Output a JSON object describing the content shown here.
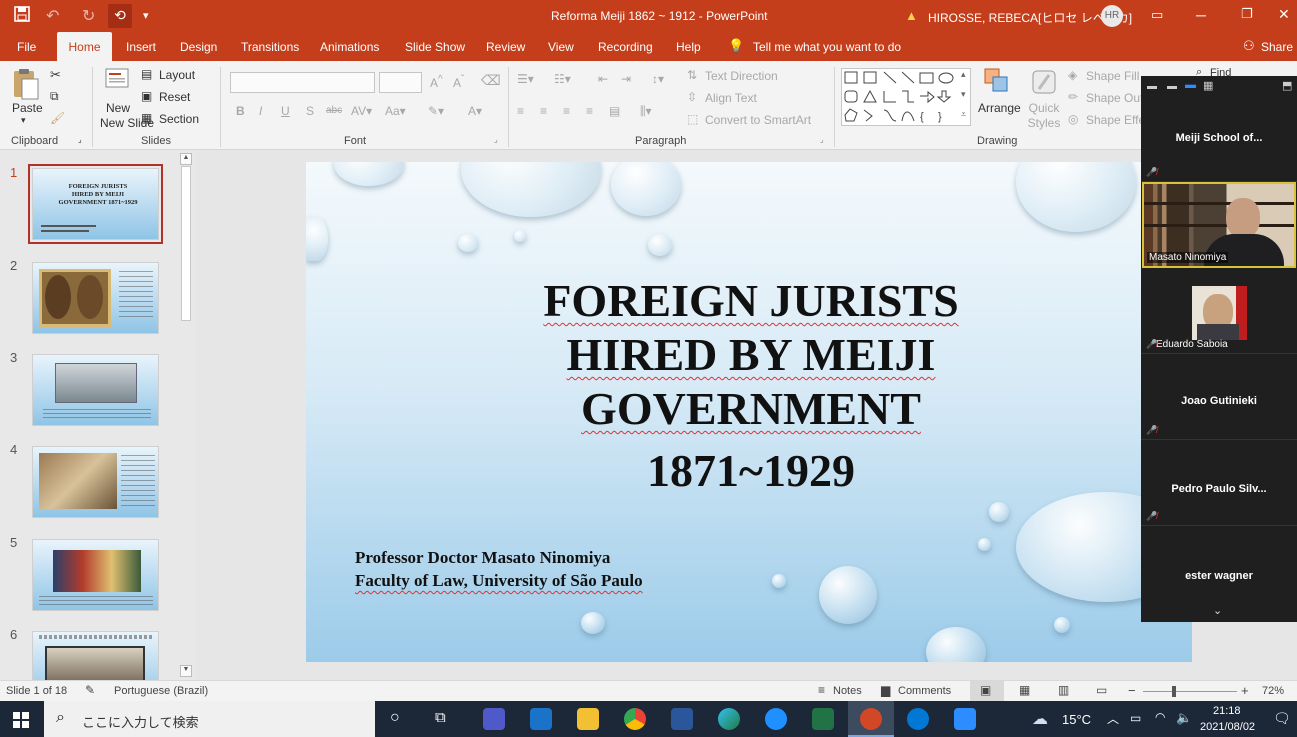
{
  "title_bar": {
    "document_title": "Reforma Meiji 1862 ~ 1912  -  PowerPoint",
    "user_name": "HIROSSE, REBECA[ヒロセ レベッカ]",
    "user_initials": "HR"
  },
  "tabs": [
    "File",
    "Home",
    "Insert",
    "Design",
    "Transitions",
    "Animations",
    "Slide Show",
    "Review",
    "View",
    "Recording",
    "Help"
  ],
  "tell_me": "Tell me what you want to do",
  "share": "Share",
  "ribbon": {
    "clipboard": {
      "paste": "Paste",
      "label": "Clipboard"
    },
    "slides": {
      "new_slide": "New Slide",
      "layout": "Layout",
      "reset": "Reset",
      "section": "Section",
      "label": "Slides"
    },
    "font": {
      "label": "Font"
    },
    "paragraph": {
      "text_direction": "Text Direction",
      "align_text": "Align Text",
      "smartart": "Convert to SmartArt",
      "label": "Paragraph"
    },
    "drawing": {
      "arrange": "Arrange",
      "quick_styles": "Quick Styles",
      "shape_fill": "Shape Fill",
      "shape_outline": "Shape Out",
      "shape_effects": "Shape Effe",
      "label": "Drawing"
    },
    "find": "Find"
  },
  "thumbnails": [
    "1",
    "2",
    "3",
    "4",
    "5",
    "6"
  ],
  "thumb_texts": {
    "t1": "FOREIGN JURISTS HIRED BY MEIJI GOVERNMENT 1871~1929"
  },
  "slide": {
    "title_lines": [
      "FOREIGN JURISTS",
      "HIRED BY MEIJI",
      "GOVERNMENT"
    ],
    "year": "1871~1929",
    "author": "Professor Doctor Masato Ninomiya",
    "affiliation": "Faculty of  Law, University of São Paulo"
  },
  "zoom_participants": [
    {
      "name": "Meiji  School  of..."
    },
    {
      "name": "Masato Ninomiya"
    },
    {
      "name": "Eduardo Saboia"
    },
    {
      "name": "Joao Gutinieki"
    },
    {
      "name": "Pedro  Paulo  Silv..."
    },
    {
      "name": "ester wagner"
    }
  ],
  "status": {
    "slide_of": "Slide 1 of 18",
    "language": "Portuguese (Brazil)",
    "notes": "Notes",
    "comments": "Comments",
    "zoom": "72%"
  },
  "taskbar": {
    "search_placeholder": "ここに入力して検索",
    "weather": "15°C",
    "time": "21:18",
    "date": "2021/08/02"
  },
  "colors": {
    "accent": "#c43e1c",
    "taskbar": "#1c2738",
    "slide_bg": "#9ccbe9"
  }
}
